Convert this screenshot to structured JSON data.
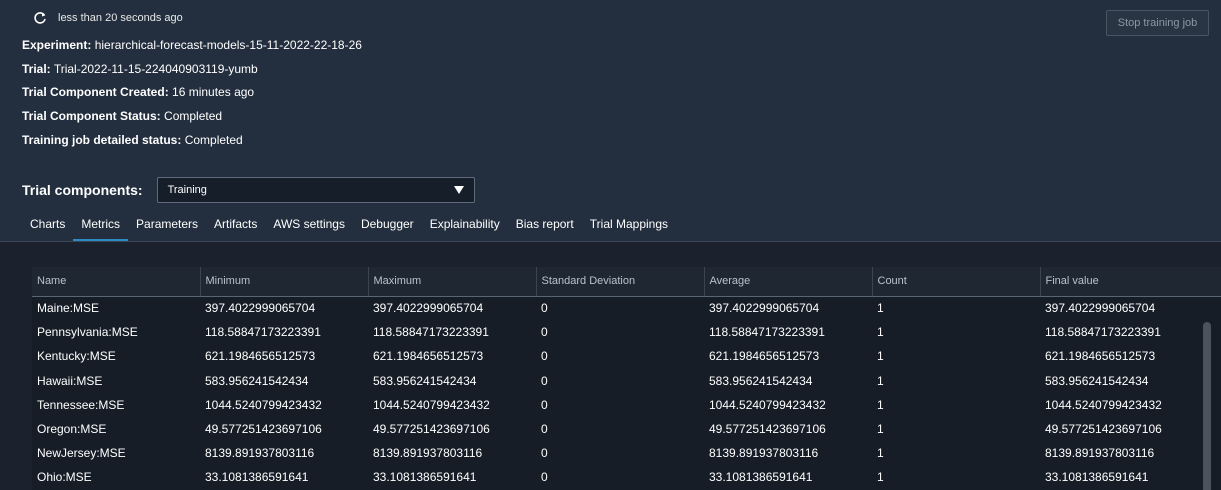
{
  "header": {
    "refresh_icon": "refresh-icon",
    "last_refreshed": "less than 20 seconds ago",
    "stop_button_label": "Stop training job"
  },
  "info": {
    "experiment_label": "Experiment:",
    "experiment_value": "hierarchical-forecast-models-15-11-2022-22-18-26",
    "trial_label": "Trial:",
    "trial_value": "Trial-2022-11-15-224040903119-yumb",
    "created_label": "Trial Component Created:",
    "created_value": "16 minutes ago",
    "status_label": "Trial Component Status:",
    "status_value": "Completed",
    "job_status_label": "Training job detailed status:",
    "job_status_value": "Completed"
  },
  "trial_components": {
    "label": "Trial components:",
    "selected": "Training"
  },
  "tabs": [
    {
      "label": "Charts",
      "active": false
    },
    {
      "label": "Metrics",
      "active": true
    },
    {
      "label": "Parameters",
      "active": false
    },
    {
      "label": "Artifacts",
      "active": false
    },
    {
      "label": "AWS settings",
      "active": false
    },
    {
      "label": "Debugger",
      "active": false
    },
    {
      "label": "Explainability",
      "active": false
    },
    {
      "label": "Bias report",
      "active": false
    },
    {
      "label": "Trial Mappings",
      "active": false
    }
  ],
  "metrics_table": {
    "columns": [
      "Name",
      "Minimum",
      "Maximum",
      "Standard Deviation",
      "Average",
      "Count",
      "Final value"
    ],
    "rows": [
      [
        "Maine:MSE",
        "397.4022999065704",
        "397.4022999065704",
        "0",
        "397.4022999065704",
        "1",
        "397.4022999065704"
      ],
      [
        "Pennsylvania:MSE",
        "118.58847173223391",
        "118.58847173223391",
        "0",
        "118.58847173223391",
        "1",
        "118.58847173223391"
      ],
      [
        "Kentucky:MSE",
        "621.1984656512573",
        "621.1984656512573",
        "0",
        "621.1984656512573",
        "1",
        "621.1984656512573"
      ],
      [
        "Hawaii:MSE",
        "583.956241542434",
        "583.956241542434",
        "0",
        "583.956241542434",
        "1",
        "583.956241542434"
      ],
      [
        "Tennessee:MSE",
        "1044.5240799423432",
        "1044.5240799423432",
        "0",
        "1044.5240799423432",
        "1",
        "1044.5240799423432"
      ],
      [
        "Oregon:MSE",
        "49.577251423697106",
        "49.577251423697106",
        "0",
        "49.577251423697106",
        "1",
        "49.577251423697106"
      ],
      [
        "NewJersey:MSE",
        "8139.891937803116",
        "8139.891937803116",
        "0",
        "8139.891937803116",
        "1",
        "8139.891937803116"
      ],
      [
        "Ohio:MSE",
        "33.1081386591641",
        "33.1081386591641",
        "0",
        "33.1081386591641",
        "1",
        "33.1081386591641"
      ]
    ]
  },
  "colors": {
    "background": "#232f3e",
    "content_background": "#1b222d",
    "active_tab_underline": "#2e8bc0"
  }
}
